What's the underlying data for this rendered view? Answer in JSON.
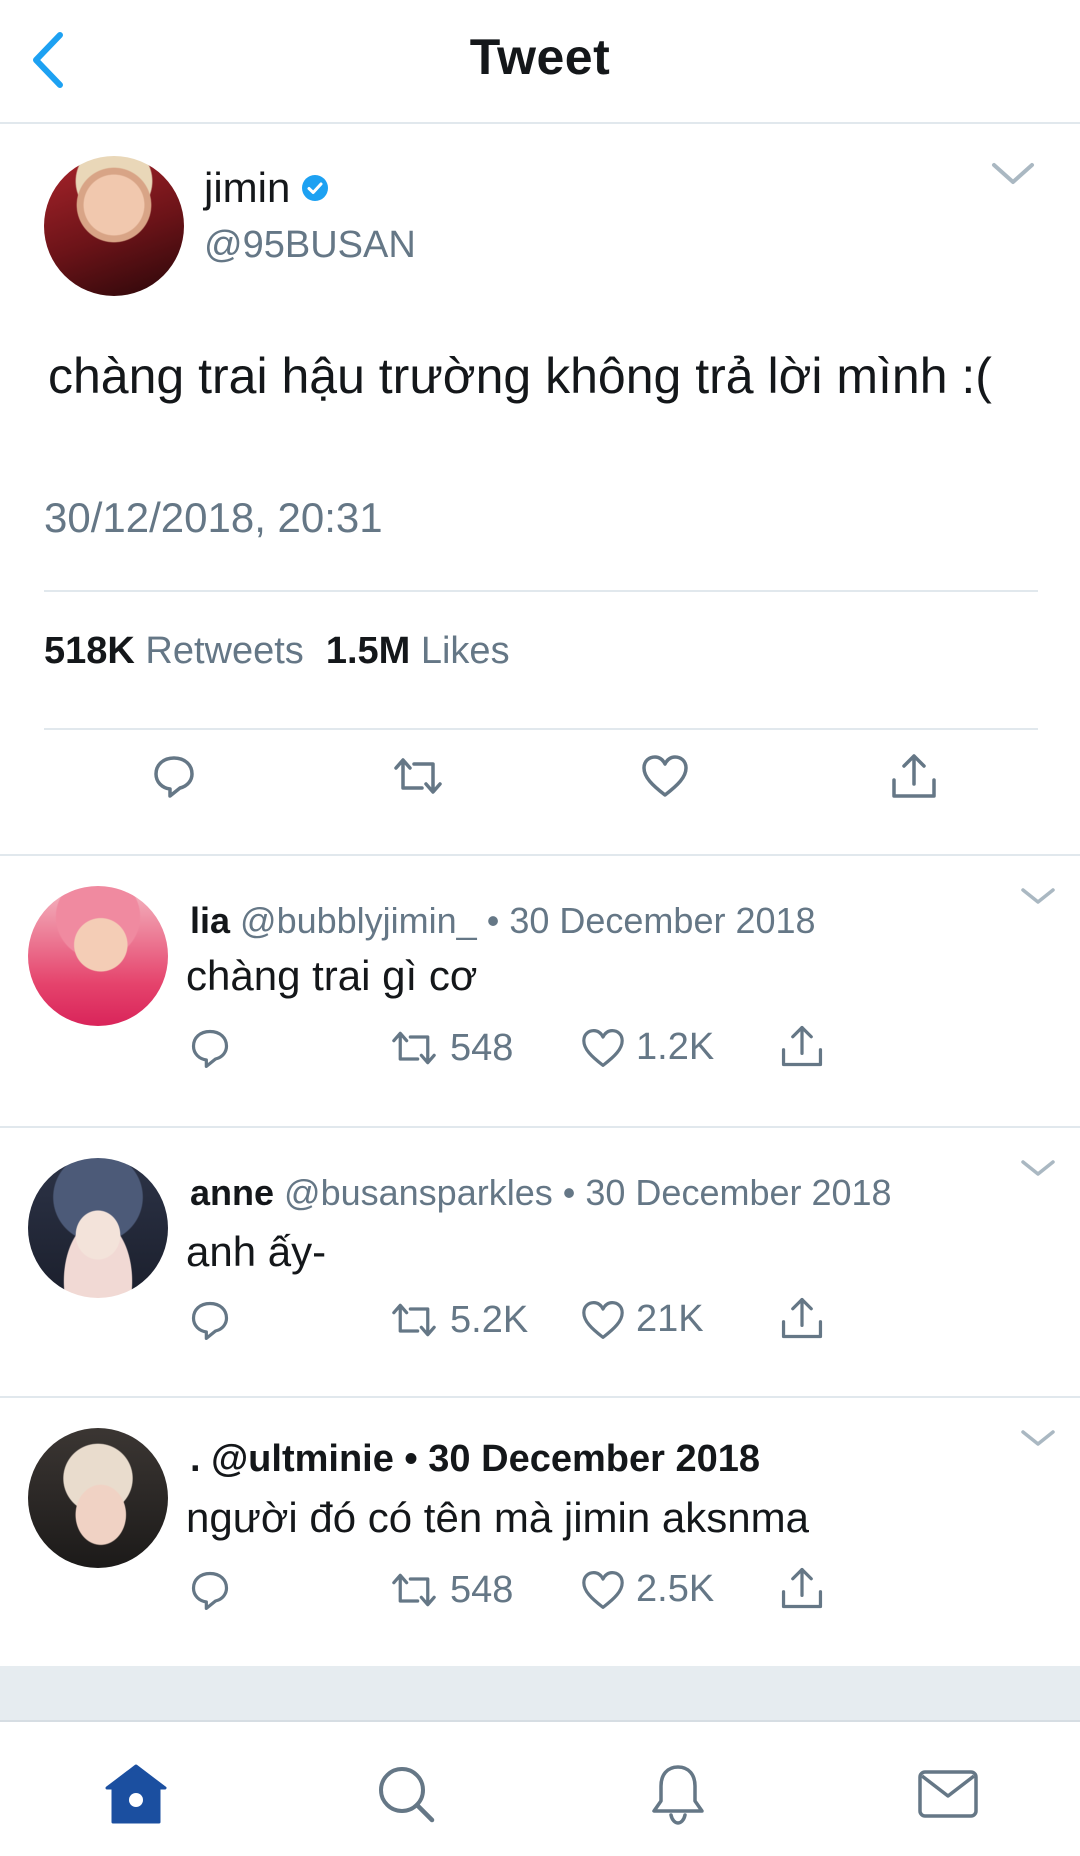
{
  "header": {
    "title": "Tweet"
  },
  "tweet": {
    "name": "jimin",
    "handle": "@95BUSAN",
    "text": "chàng trai hậu trường không trả lời mình :(",
    "timestamp": "30/12/2018, 20:31",
    "retweets_count": "518K",
    "retweets_label": "Retweets",
    "likes_count": "1.5M",
    "likes_label": "Likes"
  },
  "replies": [
    {
      "name": "lia",
      "handle": "@bubblyjimin_",
      "date": "30 December 2018",
      "text": "chàng trai gì cơ",
      "retweets": "548",
      "likes": "1.2K"
    },
    {
      "name": "anne",
      "handle": "@busansparkles",
      "date": "30 December 2018",
      "text": "anh ấy-",
      "retweets": "5.2K",
      "likes": "21K"
    },
    {
      "name": ".",
      "handle": "@ultminie",
      "date": "30 December 2018",
      "text": "người đó có tên mà jimin aksnma",
      "retweets": "548",
      "likes": "2.5K"
    }
  ],
  "separator": "•",
  "colors": {
    "accent": "#1da1f2",
    "nav_blue": "#1b4fa0",
    "secondary": "#657786",
    "divider": "#e1e8ed"
  },
  "icons": [
    "back-chevron-icon",
    "verified-badge-icon",
    "chevron-down-icon",
    "reply-icon",
    "retweet-icon",
    "like-icon",
    "share-icon",
    "home-icon",
    "search-icon",
    "notifications-icon",
    "messages-icon"
  ]
}
